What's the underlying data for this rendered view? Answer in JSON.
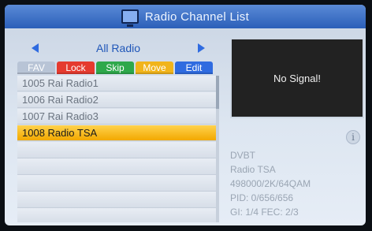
{
  "title": "Radio Channel List",
  "group": {
    "label": "All Radio"
  },
  "buttons": [
    {
      "label": "FAV",
      "color": "#b8c4d6"
    },
    {
      "label": "Lock",
      "color": "#e53a2f"
    },
    {
      "label": "Skip",
      "color": "#2ea84b"
    },
    {
      "label": "Move",
      "color": "#f1b41b"
    },
    {
      "label": "Edit",
      "color": "#2f6be0"
    }
  ],
  "channels": [
    {
      "label": "1005 Rai Radio1",
      "selected": false
    },
    {
      "label": "1006 Rai Radio2",
      "selected": false
    },
    {
      "label": "1007 Rai Radio3",
      "selected": false
    },
    {
      "label": "1008 Radio TSA",
      "selected": true
    }
  ],
  "preview": {
    "status": "No Signal!"
  },
  "info": {
    "type": "DVBT",
    "channel": "Radio TSA",
    "params": "498000/2K/64QAM",
    "pid": "PID: 0/656/656",
    "gi_fec": "GI: 1/4  FEC: 2/3"
  }
}
